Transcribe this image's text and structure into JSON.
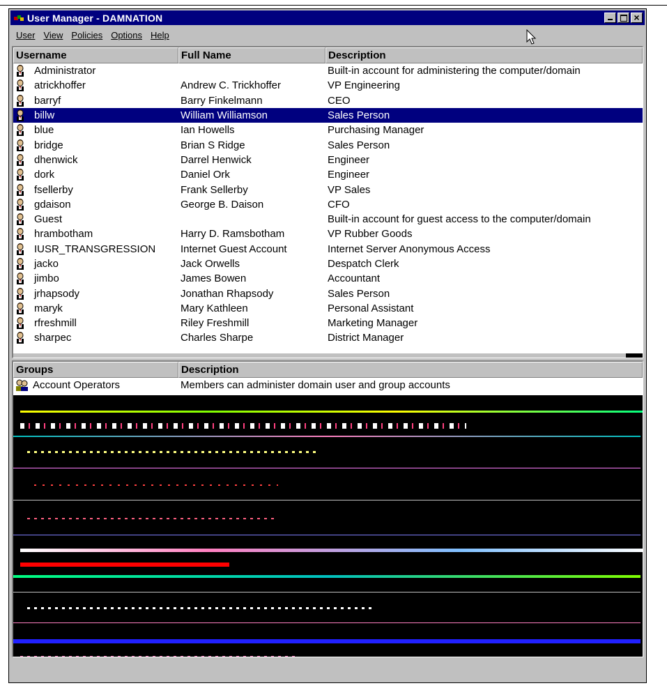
{
  "window": {
    "title": "User Manager - DAMNATION"
  },
  "menu": [
    "User",
    "View",
    "Policies",
    "Options",
    "Help"
  ],
  "users_table": {
    "columns": [
      "Username",
      "Full Name",
      "Description"
    ],
    "rows": [
      {
        "username": "Administrator",
        "full_name": "",
        "description": "Built-in account for administering the computer/domain"
      },
      {
        "username": "atrickhoffer",
        "full_name": "Andrew C. Trickhoffer",
        "description": "VP Engineering"
      },
      {
        "username": "barryf",
        "full_name": "Barry Finkelmann",
        "description": "CEO"
      },
      {
        "username": "billw",
        "full_name": "William Williamson",
        "description": "Sales Person",
        "selected": true
      },
      {
        "username": "blue",
        "full_name": "Ian Howells",
        "description": "Purchasing Manager"
      },
      {
        "username": "bridge",
        "full_name": "Brian S Ridge",
        "description": "Sales Person"
      },
      {
        "username": "dhenwick",
        "full_name": "Darrel Henwick",
        "description": "Engineer"
      },
      {
        "username": "dork",
        "full_name": "Daniel Ork",
        "description": "Engineer"
      },
      {
        "username": "fsellerby",
        "full_name": "Frank Sellerby",
        "description": "VP Sales"
      },
      {
        "username": "gdaison",
        "full_name": "George B. Daison",
        "description": "CFO"
      },
      {
        "username": "Guest",
        "full_name": "",
        "description": "Built-in account for guest access to the computer/domain"
      },
      {
        "username": "hrambotham",
        "full_name": "Harry D. Ramsbotham",
        "description": "VP Rubber Goods"
      },
      {
        "username": "IUSR_TRANSGRESSION",
        "full_name": "Internet Guest Account",
        "description": "Internet Server Anonymous Access"
      },
      {
        "username": "jacko",
        "full_name": "Jack Orwells",
        "description": "Despatch Clerk"
      },
      {
        "username": "jimbo",
        "full_name": "James Bowen",
        "description": "Accountant"
      },
      {
        "username": "jrhapsody",
        "full_name": "Jonathan Rhapsody",
        "description": "Sales Person"
      },
      {
        "username": "maryk",
        "full_name": "Mary Kathleen",
        "description": "Personal Assistant"
      },
      {
        "username": "rfreshmill",
        "full_name": "Riley Freshmill",
        "description": "Marketing Manager"
      },
      {
        "username": "sharpec",
        "full_name": "Charles Sharpe",
        "description": "District Manager"
      }
    ]
  },
  "groups_table": {
    "columns": [
      "Groups",
      "Description"
    ],
    "rows": [
      {
        "name": "Account Operators",
        "description": "Members can administer domain user and group accounts"
      }
    ]
  },
  "colors": {
    "titlebar": "#00007f",
    "selection": "#00007f",
    "chrome": "#c0c0c0"
  }
}
